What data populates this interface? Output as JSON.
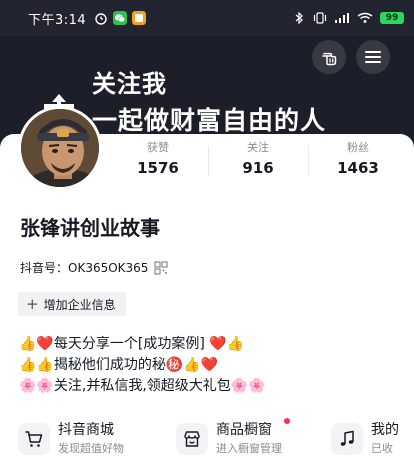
{
  "status_bar": {
    "time": "下午3:14",
    "battery": "99"
  },
  "banner": {
    "line1": "关注我",
    "line2": "一起做财富自由的人"
  },
  "profile": {
    "stats": [
      {
        "label": "获赞",
        "value": "1576"
      },
      {
        "label": "关注",
        "value": "916"
      },
      {
        "label": "粉丝",
        "value": "1463"
      }
    ],
    "name": "张锋讲创业故事",
    "douyin_id": "抖音号：OK365OK365",
    "enterprise_button": "增加企业信息",
    "bio": [
      "👍❤️每天分享一个[成功案例] ❤️👍",
      "👍👍揭秘他们成功的秘㊙️👍❤️",
      "🌸🌸关注,并私信我,领超级大礼包🌸🌸"
    ]
  },
  "shortcuts": [
    {
      "title": "抖音商城",
      "subtitle": "发现超值好物",
      "icon": "cart-icon"
    },
    {
      "title": "商品橱窗",
      "subtitle": "进入橱窗管理",
      "icon": "showcase-icon"
    },
    {
      "title": "我的",
      "subtitle": "已收",
      "icon": "music-note-icon"
    }
  ],
  "colors": {
    "banner_bg": "#1c1f29",
    "accent_dot": "#fe2c55",
    "battery": "#2bd65c"
  }
}
